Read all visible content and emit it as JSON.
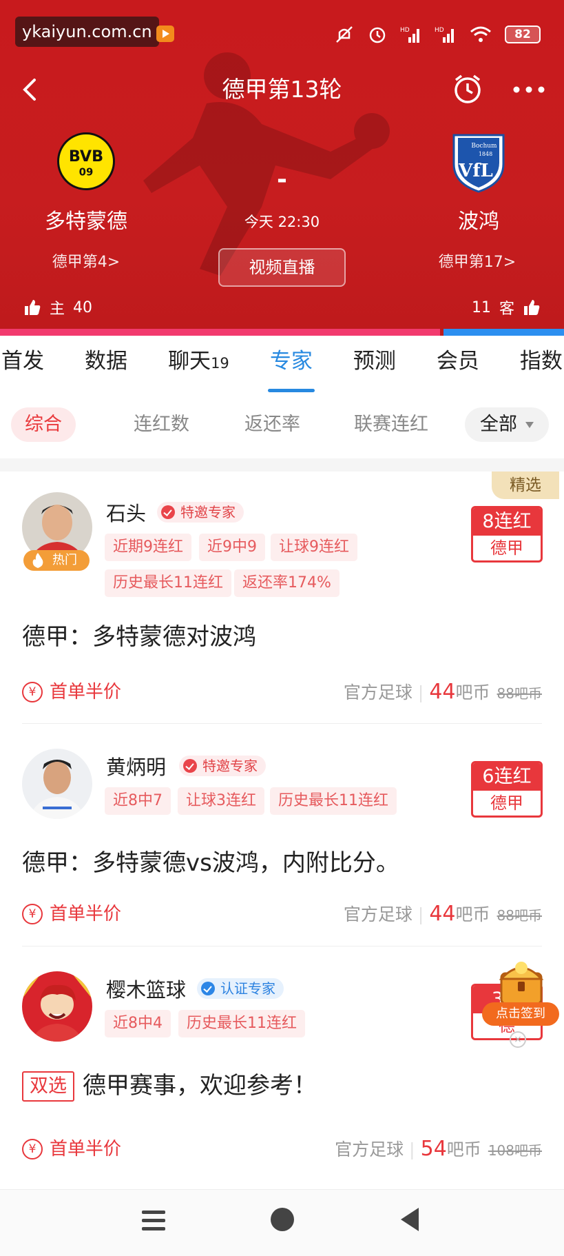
{
  "status_bar": {
    "watermark": "ykaiyun.com.cn",
    "battery": "82"
  },
  "header": {
    "title": "德甲第13轮",
    "home_team": "多特蒙德",
    "away_team": "波鸿",
    "home_logo_text": "BVB",
    "home_logo_num": "09",
    "away_logo_text": "Bochum",
    "away_logo_year": "1848",
    "away_logo_letters": "VfL",
    "score": "-",
    "time": "今天 22:30",
    "home_rank": "德甲第4>",
    "away_rank": "德甲第17>",
    "live_button": "视频直播",
    "home_vote_label": "主",
    "home_vote_count": "40",
    "away_vote_label": "客",
    "away_vote_count": "11",
    "home_vote_share": 0.784
  },
  "tabs": [
    {
      "label": "首发",
      "sub": ""
    },
    {
      "label": "数据",
      "sub": ""
    },
    {
      "label": "聊天",
      "sub": "19"
    },
    {
      "label": "专家",
      "sub": ""
    },
    {
      "label": "预测",
      "sub": ""
    },
    {
      "label": "会员",
      "sub": ""
    },
    {
      "label": "指数",
      "sub": ""
    }
  ],
  "filters": {
    "items": [
      "综合",
      "连红数",
      "返还率",
      "联赛连红"
    ],
    "all": "全部"
  },
  "experts": [
    {
      "name": "石头",
      "badge": "特邀专家",
      "hot": "热门",
      "selected": "精选",
      "tags": [
        "近期9连红",
        "近9中9",
        "让球9连红",
        "历史最长11连红",
        "返还率174%"
      ],
      "streak": "8连红",
      "league": "德甲",
      "dual": "",
      "desc": "德甲：多特蒙德对波鸿",
      "promo": "首单半价",
      "source": "官方足球",
      "price": "44",
      "unit": "吧币",
      "old_price": "88吧币"
    },
    {
      "name": "黄炳明",
      "badge": "特邀专家",
      "tags": [
        "近8中7",
        "让球3连红",
        "历史最长11连红"
      ],
      "streak": "6连红",
      "league": "德甲",
      "dual": "",
      "desc": "德甲：多特蒙德vs波鸿，内附比分。",
      "promo": "首单半价",
      "source": "官方足球",
      "price": "44",
      "unit": "吧币",
      "old_price": "88吧币"
    },
    {
      "name": "樱木篮球",
      "badge": "认证专家",
      "tags": [
        "近8中4",
        "历史最长11连红"
      ],
      "streak": "3连",
      "league": "德",
      "dual": "双选",
      "desc": "德甲赛事，欢迎参考！",
      "promo": "首单半价",
      "source": "官方足球",
      "price": "54",
      "unit": "吧币",
      "old_price": "108吧币"
    }
  ],
  "floating": {
    "checkin": "点击签到"
  },
  "icons": {
    "back": "back-arrow-icon",
    "alarm": "alarm-clock-icon",
    "more": "more-dots-icon",
    "like": "thumb-up-icon",
    "yen": "yen-coin-icon"
  },
  "colors": {
    "header_red": "#c81a1d",
    "accent_blue": "#2789e0",
    "accent_red": "#e8373c",
    "home_bar": "#f23a6e",
    "away_bar": "#2c8ff0"
  }
}
